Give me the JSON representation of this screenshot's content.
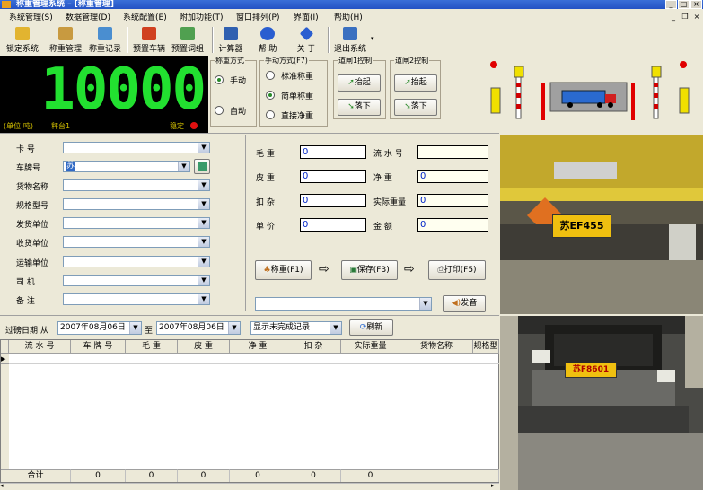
{
  "window": {
    "title": "称重管理系统  – [称重管理]",
    "btn_min": "_",
    "btn_max": "□",
    "btn_close": "×"
  },
  "menu": [
    "系统管理(S)",
    "数据管理(D)",
    "系统配置(E)",
    "附加功能(T)",
    "窗口排列(P)",
    "界面(I)",
    "帮助(H)"
  ],
  "toolbar": [
    "锁定系统",
    "称重管理",
    "称重记录",
    "预置车辆",
    "预置词组",
    "计算器",
    "帮 助",
    "关 于",
    "退出系统"
  ],
  "led": {
    "value": "10000",
    "unit": "(单位:吨)",
    "platform": "秤台1",
    "status": "稳定"
  },
  "weigh_mode": {
    "title": "称重方式",
    "options": [
      "手动",
      "自动"
    ],
    "selected": 0
  },
  "manual_mode": {
    "title": "手动方式(F7)",
    "options": [
      "标准称重",
      "简单称重",
      "直接净重"
    ],
    "selected": 1
  },
  "gate1": {
    "title": "道闸1控制",
    "up": "抬起",
    "down": "落下"
  },
  "gate2": {
    "title": "道闸2控制",
    "up": "抬起",
    "down": "落下"
  },
  "form": {
    "labels": [
      "卡   号",
      "车牌号",
      "货物名称",
      "规格型号",
      "发货单位",
      "收货单位",
      "运输单位",
      "司   机",
      "备   注"
    ],
    "plate_value": "苏"
  },
  "weights": {
    "gross_label": "毛    重",
    "gross": "0",
    "tare_label": "皮    重",
    "tare": "0",
    "deduct_label": "扣    杂",
    "deduct": "0",
    "price_label": "单    价",
    "price": "0",
    "serial_label": "流 水 号",
    "serial": "",
    "net_label": "净    重",
    "net": "0",
    "actual_label": "实际重量",
    "actual": "0",
    "amount_label": "金    额",
    "amount": "0"
  },
  "actions": {
    "weigh": "称重(F1)",
    "save": "保存(F3)",
    "print": "打印(F5)",
    "announce": "发音"
  },
  "filter": {
    "label": "过磅日期  从",
    "from": "2007年08月06日",
    "to_label": "至",
    "to": "2007年08月06日",
    "show": "显示未完成记录",
    "refresh": "刷新"
  },
  "grid": {
    "columns": [
      "流 水 号",
      "车 牌 号",
      "毛   重",
      "皮   重",
      "净   重",
      "扣   杂",
      "实际重量",
      "货物名称",
      "规格型"
    ],
    "footer": [
      "合计",
      "0",
      "0",
      "0",
      "0",
      "0",
      "0"
    ]
  },
  "camera": {
    "plate1": "苏EF455",
    "plate2": "苏F8601"
  }
}
